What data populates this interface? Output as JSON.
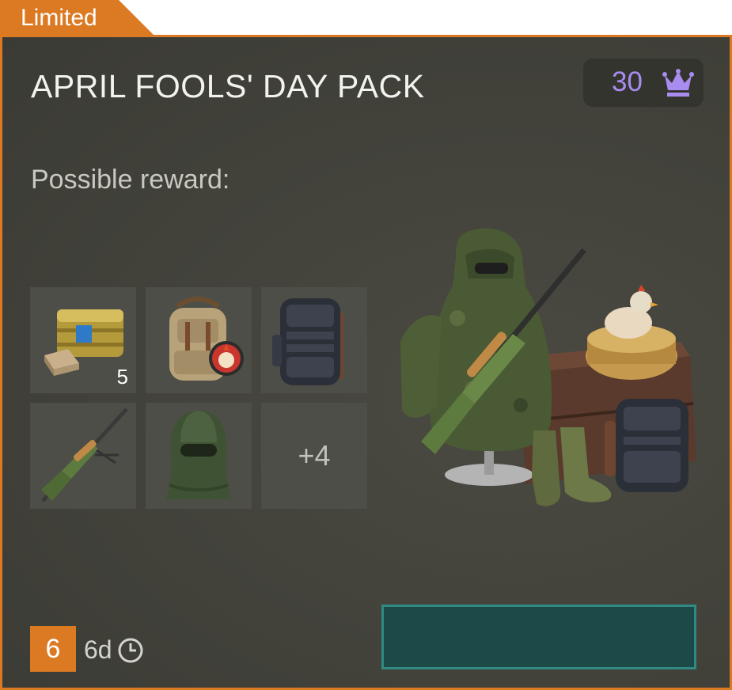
{
  "badge": {
    "label": "Limited",
    "color": "#dc7a24"
  },
  "pack": {
    "title": "APRIL FOOLS' DAY PACK"
  },
  "price": {
    "value": "30",
    "icon": "crown-icon",
    "color": "#a98cf0"
  },
  "rewards": {
    "heading": "Possible reward:",
    "items": [
      {
        "name": "emergency-ration-crate",
        "count": "5"
      },
      {
        "name": "chicken-backpack",
        "count": ""
      },
      {
        "name": "tactical-backpack",
        "count": ""
      },
      {
        "name": "sniper-rifle",
        "count": ""
      },
      {
        "name": "balaclava",
        "count": ""
      },
      {
        "name": "more-rewards",
        "count": "+4"
      }
    ]
  },
  "footer": {
    "counter": "6",
    "timer": "6d",
    "timer_icon": "clock-icon"
  },
  "buy_button": {
    "label": "",
    "color": "#1d4a48"
  }
}
